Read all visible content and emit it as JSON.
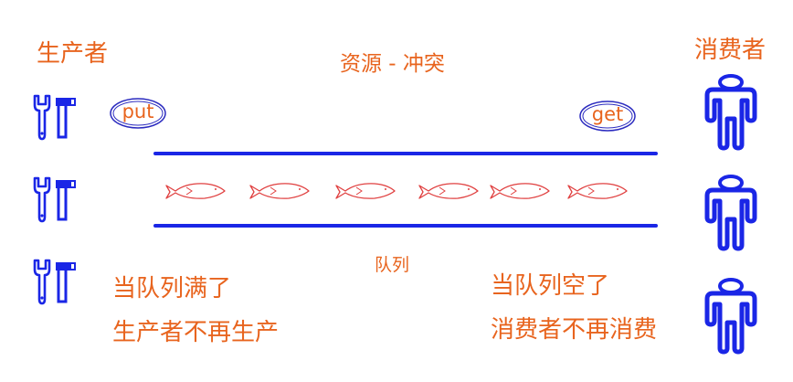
{
  "labels": {
    "producer": "生产者",
    "consumer": "消费者",
    "title": "资源 - 冲突",
    "queue": "队列",
    "put": "put",
    "get": "get",
    "queue_full": "当队列满了",
    "producer_stop": "生产者不再生产",
    "queue_empty": "当队列空了",
    "consumer_stop": "消费者不再消费"
  },
  "icons": {
    "producer": "wrench-hammer-icon",
    "consumer": "person-icon",
    "item": "fish-icon"
  },
  "queue_item_count": 6,
  "producer_count": 3,
  "consumer_count": 3,
  "colors": {
    "text": "#e8641e",
    "icon": "#1a26e6",
    "fish": "#e04040",
    "pill": "#2a2abf"
  }
}
